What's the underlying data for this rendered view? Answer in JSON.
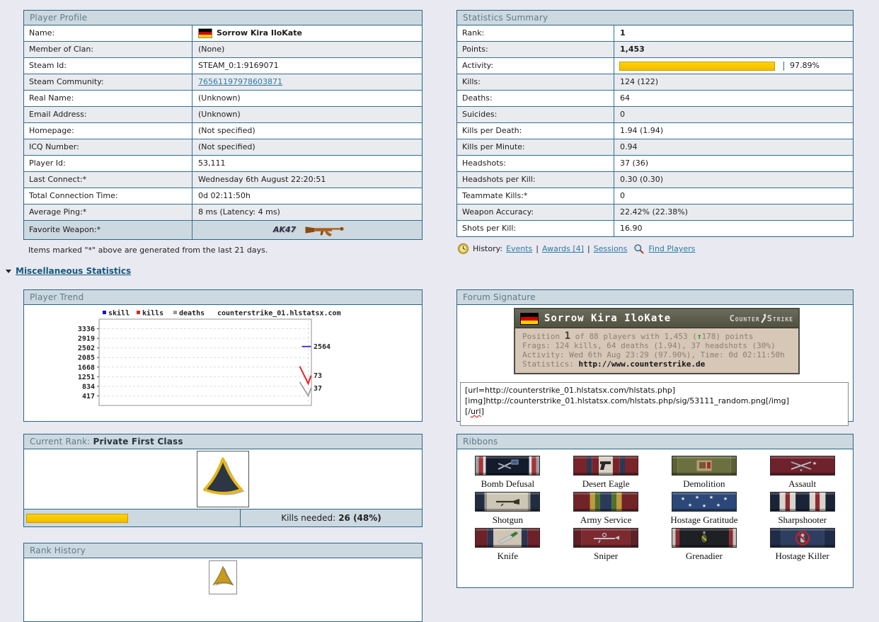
{
  "profile": {
    "title": "Player Profile",
    "rows": [
      {
        "label": "Name:",
        "value": "Sorrow Kira IloKate",
        "type": "name"
      },
      {
        "label": "Member of Clan:",
        "value": "(None)"
      },
      {
        "label": "Steam Id:",
        "value": "STEAM_0:1:9169071"
      },
      {
        "label": "Steam Community:",
        "value": "76561197978603871",
        "type": "link"
      },
      {
        "label": "Real Name:",
        "value": "(Unknown)"
      },
      {
        "label": "Email Address:",
        "value": "(Unknown)"
      },
      {
        "label": "Homepage:",
        "value": "(Not specified)"
      },
      {
        "label": "ICQ Number:",
        "value": "(Not specified)"
      },
      {
        "label": "Player Id:",
        "value": "53,111"
      },
      {
        "label": "Last Connect:*",
        "value": "Wednesday 6th August 22:20:51"
      },
      {
        "label": "Total Connection Time:",
        "value": "0d 02:11:50h"
      },
      {
        "label": "Average Ping:*",
        "value": "8 ms (Latency: 4 ms)"
      },
      {
        "label": "Favorite Weapon:*",
        "value": "AK47",
        "type": "weapon"
      }
    ],
    "footnote": "Items marked \"*\" above are generated from the last 21 days."
  },
  "stats": {
    "title": "Statistics Summary",
    "rows": [
      {
        "label": "Rank:",
        "value": "1",
        "bold": true
      },
      {
        "label": "Points:",
        "value": "1,453",
        "bold": true
      },
      {
        "label": "Activity:",
        "value": "97.89%",
        "type": "activity",
        "percent": 97.89
      },
      {
        "label": "Kills:",
        "value": "124 (122)"
      },
      {
        "label": "Deaths:",
        "value": "64"
      },
      {
        "label": "Suicides:",
        "value": "0"
      },
      {
        "label": "Kills per Death:",
        "value": "1.94 (1.94)"
      },
      {
        "label": "Kills per Minute:",
        "value": "0.94"
      },
      {
        "label": "Headshots:",
        "value": "37 (36)"
      },
      {
        "label": "Headshots per Kill:",
        "value": "0.30 (0.30)"
      },
      {
        "label": "Teammate Kills:*",
        "value": "0"
      },
      {
        "label": "Weapon Accuracy:",
        "value": "22.42% (22.38%)"
      },
      {
        "label": "Shots per Kill:",
        "value": "16.90"
      }
    ]
  },
  "history": {
    "label": "History:",
    "links": [
      "Events",
      "Awards [4]",
      "Sessions"
    ],
    "find_label": "Find Players"
  },
  "misc_link_label": "Miscellaneous Statistics",
  "player_trend_title": "Player Trend",
  "chart_data": {
    "type": "line",
    "title": "counterstrike_01.hlstatsx.com",
    "legend_position": "top-left",
    "grid": "dashed",
    "ylim": [
      0,
      3753
    ],
    "yticks": [
      3336,
      2919,
      2502,
      2085,
      1668,
      1251,
      834,
      417
    ],
    "series": [
      {
        "name": "skill",
        "color": "#1414cc",
        "points": [
          [
            0.955,
            2564
          ],
          [
            0.998,
            2564
          ]
        ],
        "end_label": "2564"
      },
      {
        "name": "kills",
        "color": "#e82222",
        "points": [
          [
            0.945,
            1700
          ],
          [
            0.985,
            950
          ],
          [
            0.998,
            1300
          ]
        ],
        "end_label": "73"
      },
      {
        "name": "deaths",
        "color": "#999999",
        "points": [
          [
            0.945,
            1020
          ],
          [
            0.985,
            420
          ],
          [
            0.998,
            760
          ]
        ],
        "end_label": "37"
      }
    ]
  },
  "signature": {
    "title": "Forum Signature",
    "player_name": "Sorrow Kira IloKate",
    "logo_left": "Counter",
    "logo_right": "Strike",
    "position_label": "Position ",
    "position_value": "1",
    "position_mid": " of 88 players with 1,453 (",
    "delta_arrow": "↑",
    "delta_value": "178",
    "position_end": ") points",
    "frags_line": "Frags: 124 kills, 64 deaths (1.94), 37 headshots (30%)",
    "activity_line": "Activity: Wed 6th Aug 23:29 (97.90%), Time: 0d 02:11:50h",
    "stats_label": "Statistics: ",
    "stats_url": "http://www.counterstrike.de",
    "bbcode_line1": "[url=http://counterstrike_01.hlstatsx.com/hlstats.php]",
    "bbcode_line2": "[img]http://counterstrike_01.hlstatsx.com/hlstats.php/sig/53111_random.png[/img]",
    "bbcode_line3_a": "[/",
    "bbcode_line3_b": "url",
    "bbcode_line3_c": "]"
  },
  "current_rank": {
    "title": "Current Rank: ",
    "rank_name": "Private First Class",
    "kills_needed_label": "Kills needed:",
    "kills_needed_value": "26 (48%)",
    "progress_percent": 48
  },
  "rank_history_title": "Rank History",
  "ribbons": {
    "title": "Ribbons",
    "items": [
      {
        "label": "Bomb Defusal",
        "icon": "pliers",
        "stripes": [
          [
            "#9aa0a8",
            5
          ],
          [
            "#a83434",
            7
          ],
          [
            "#d8dce0",
            4
          ],
          [
            "#141c2c",
            68
          ],
          [
            "#d8dce0",
            4
          ],
          [
            "#a83434",
            7
          ],
          [
            "#9aa0a8",
            5
          ]
        ]
      },
      {
        "label": "Desert Eagle",
        "icon": "pistol",
        "stripes": [
          [
            "#79242a",
            20
          ],
          [
            "#2c3852",
            8
          ],
          [
            "#79242a",
            11
          ],
          [
            "#d8d2c4",
            22
          ],
          [
            "#79242a",
            11
          ],
          [
            "#2c3852",
            8
          ],
          [
            "#79242a",
            20
          ]
        ]
      },
      {
        "label": "Demolition",
        "icon": "c4",
        "stripes": [
          [
            "#5c6034",
            8
          ],
          [
            "#6b7040",
            84
          ],
          [
            "#5c6034",
            8
          ]
        ]
      },
      {
        "label": "Assault",
        "icon": "rifles",
        "stripes": [
          [
            "#6e222c",
            100
          ]
        ]
      },
      {
        "label": "Shotgun",
        "icon": "shotgun",
        "stripes": [
          [
            "#222c40",
            14
          ],
          [
            "#98948c",
            4
          ],
          [
            "#ccc6b6",
            64
          ],
          [
            "#98948c",
            4
          ],
          [
            "#222c40",
            14
          ]
        ]
      },
      {
        "label": "Army Service",
        "icon": "none",
        "stripes": [
          [
            "#702428",
            25
          ],
          [
            "#c09a3c",
            8
          ],
          [
            "#50702c",
            8
          ],
          [
            "#2a3a5a",
            18
          ],
          [
            "#50702c",
            8
          ],
          [
            "#c09a3c",
            8
          ],
          [
            "#702428",
            25
          ]
        ]
      },
      {
        "label": "Hostage Gratitude",
        "icon": "stars",
        "stripes": [
          [
            "#2c4878",
            100
          ]
        ]
      },
      {
        "label": "Sharpshooter",
        "icon": "none",
        "stripes": [
          [
            "#1a2438",
            14
          ],
          [
            "#d8d4cc",
            9
          ],
          [
            "#8c2a34",
            7
          ],
          [
            "#d8d4cc",
            9
          ],
          [
            "#1a2438",
            22
          ],
          [
            "#d8d4cc",
            9
          ],
          [
            "#8c2a34",
            7
          ],
          [
            "#d8d4cc",
            9
          ],
          [
            "#1a2438",
            14
          ]
        ]
      },
      {
        "label": "Knife",
        "icon": "knife",
        "stripes": [
          [
            "#6c2228",
            18
          ],
          [
            "#2c3450",
            10
          ],
          [
            "#cfc5b5",
            44
          ],
          [
            "#2c3450",
            10
          ],
          [
            "#6c2228",
            18
          ]
        ]
      },
      {
        "label": "Sniper",
        "icon": "sniper",
        "stripes": [
          [
            "#5e2026",
            12
          ],
          [
            "#7c2930",
            76
          ],
          [
            "#5e2026",
            12
          ]
        ]
      },
      {
        "label": "Grenadier",
        "icon": "grenade",
        "stripes": [
          [
            "#c6c2ba",
            5
          ],
          [
            "#8c2a30",
            6
          ],
          [
            "#1e2024",
            78
          ],
          [
            "#8c2a30",
            6
          ],
          [
            "#c6c2ba",
            5
          ]
        ]
      },
      {
        "label": "Hostage Killer",
        "icon": "ban",
        "stripes": [
          [
            "#1e2c48",
            16
          ],
          [
            "#2e3e60",
            68
          ],
          [
            "#1e2c48",
            16
          ]
        ]
      }
    ]
  }
}
